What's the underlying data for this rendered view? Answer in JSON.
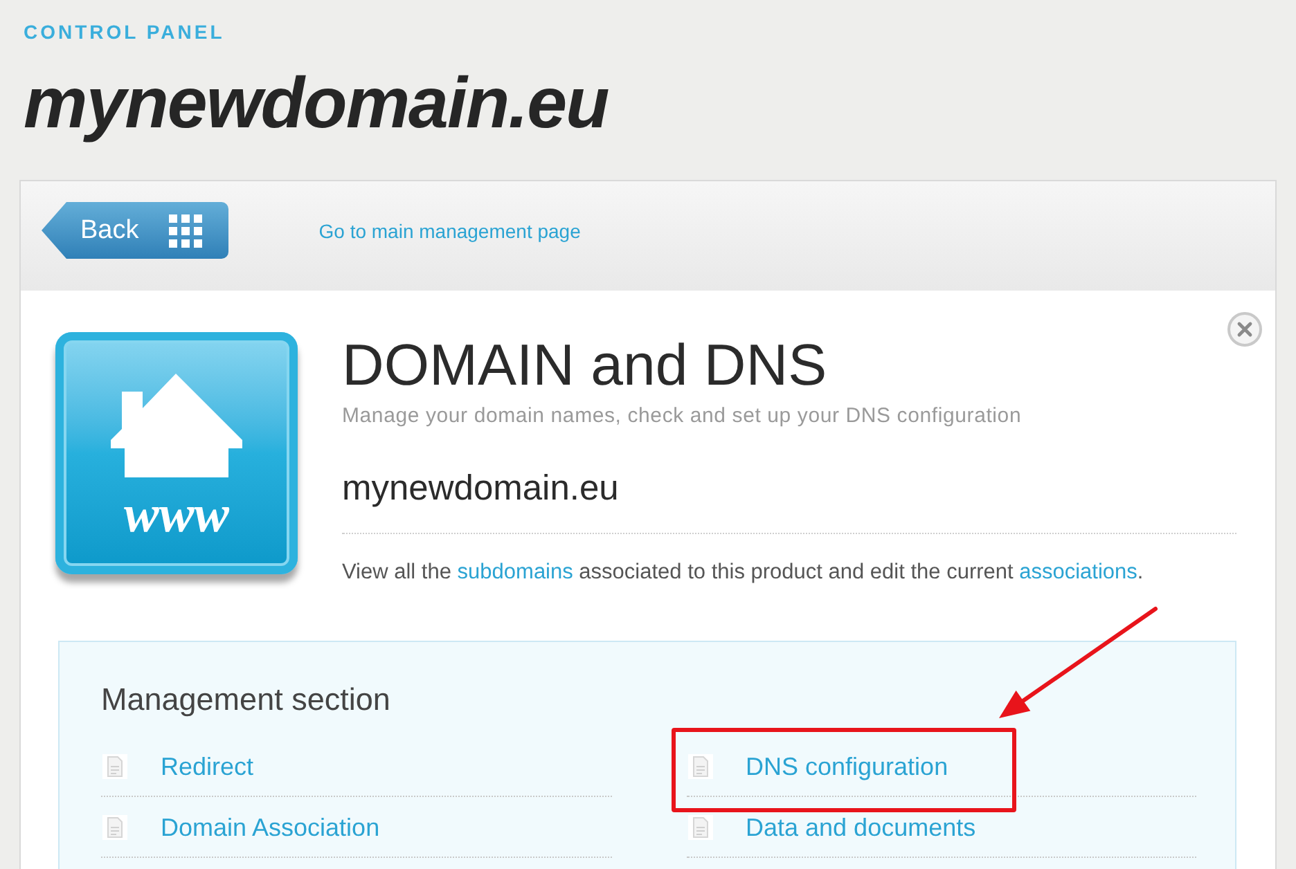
{
  "header": {
    "eyebrow": "CONTROL PANEL",
    "title": "mynewdomain.eu"
  },
  "toolbar": {
    "back_button": "Back",
    "link": "Go to main management page"
  },
  "product": {
    "logo_caption": "www",
    "title": "DOMAIN and DNS",
    "subtitle": "Manage your domain names, check and set up your DNS configuration",
    "domain": "mynewdomain.eu",
    "description": [
      {
        "kind": "text",
        "text": "View all the "
      },
      {
        "kind": "link",
        "text": "subdomains"
      },
      {
        "kind": "text",
        "text": " associated to this product and edit the current "
      },
      {
        "kind": "link",
        "text": "associations"
      },
      {
        "kind": "text",
        "text": "."
      }
    ]
  },
  "management": {
    "title": "Management section",
    "items": [
      {
        "label": "Redirect",
        "highlighted": false
      },
      {
        "label": "DNS configuration",
        "highlighted": true
      },
      {
        "label": "Domain Association",
        "highlighted": false
      },
      {
        "label": "Data and documents",
        "highlighted": false
      }
    ]
  }
}
